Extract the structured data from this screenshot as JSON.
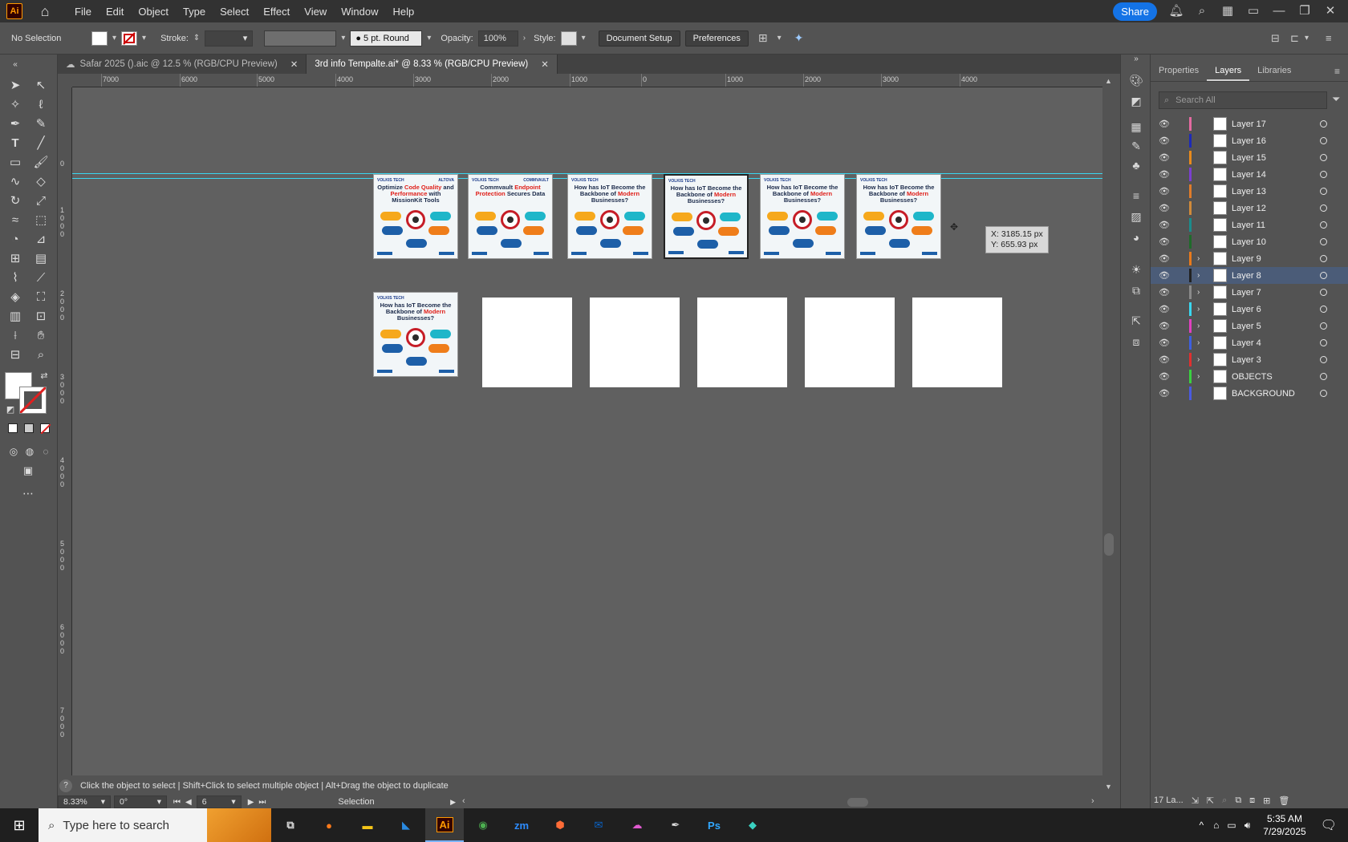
{
  "app": {
    "logo": "Ai",
    "menu": [
      "File",
      "Edit",
      "Object",
      "Type",
      "Select",
      "Effect",
      "View",
      "Window",
      "Help"
    ],
    "share_label": "Share"
  },
  "control": {
    "selection": "No Selection",
    "stroke_label": "Stroke:",
    "brush": "5 pt. Round",
    "opacity_label": "Opacity:",
    "opacity_value": "100%",
    "style_label": "Style:",
    "document_setup": "Document Setup",
    "preferences": "Preferences"
  },
  "tabs": [
    {
      "label": "Safar 2025 ().aic @ 12.5 % (RGB/CPU Preview)"
    },
    {
      "label": "3rd info Tempalte.ai* @ 8.33 % (RGB/CPU Preview)"
    }
  ],
  "ruler_top": [
    "7000",
    "6000",
    "5000",
    "4000",
    "3000",
    "2000",
    "1000",
    "0",
    "1000",
    "2000",
    "3000",
    "4000"
  ],
  "ruler_left": [
    "0",
    "1000",
    "2000",
    "3000",
    "4000",
    "5000",
    "6000",
    "7000"
  ],
  "infographics": [
    {
      "brand": "VOLKIS TECH",
      "partner": "ALTOVA",
      "title_a": "Optimize ",
      "title_red": "Code Quality",
      "title_b": " and ",
      "title_red2": "Performance",
      "title_c": " with MissionKit Tools"
    },
    {
      "brand": "VOLKIS TECH",
      "partner": "COMMVAULT",
      "title_a": "Commvault ",
      "title_red": "Endpoint Protection",
      "title_b": " Secures Data",
      "title_red2": "",
      "title_c": ""
    },
    {
      "brand": "VOLKIS TECH",
      "partner": "",
      "title_a": "How has IoT Become the Backbone of ",
      "title_red": "Modern",
      "title_b": " Businesses?",
      "title_red2": "",
      "title_c": ""
    },
    {
      "brand": "VOLKIS TECH",
      "partner": "",
      "title_a": "How has IoT Become the Backbone of ",
      "title_red": "Modern",
      "title_b": " Businesses?",
      "title_red2": "",
      "title_c": ""
    },
    {
      "brand": "VOLKIS TECH",
      "partner": "",
      "title_a": "How has IoT Become the Backbone of ",
      "title_red": "Modern",
      "title_b": " Businesses?",
      "title_red2": "",
      "title_c": ""
    },
    {
      "brand": "VOLKIS TECH",
      "partner": "",
      "title_a": "How has IoT Become the Backbone of ",
      "title_red": "Modern",
      "title_b": " Businesses?",
      "title_red2": "",
      "title_c": ""
    },
    {
      "brand": "VOLKIS TECH",
      "partner": "",
      "title_a": "How has IoT Become the Backbone of ",
      "title_red": "Modern",
      "title_b": " Businesses?",
      "title_red2": "",
      "title_c": ""
    }
  ],
  "tooltip": {
    "x": "X: 3185.15 px",
    "y": "Y: 655.93 px"
  },
  "status": {
    "hint": "Click the object to select  |  Shift+Click to select multiple object  |  Alt+Drag the object to duplicate",
    "zoom": "8.33%",
    "rotation": "0°",
    "artboard": "6",
    "mode": "Selection"
  },
  "panel": {
    "tabs": [
      "Properties",
      "Layers",
      "Libraries"
    ],
    "search_placeholder": "Search All",
    "layers": [
      {
        "name": "Layer 17",
        "color": "#e46aa0",
        "has_children": false
      },
      {
        "name": "Layer 16",
        "color": "#1d2ab8",
        "has_children": false
      },
      {
        "name": "Layer 15",
        "color": "#e88a1c",
        "has_children": false
      },
      {
        "name": "Layer 14",
        "color": "#7b3fd0",
        "has_children": false
      },
      {
        "name": "Layer 13",
        "color": "#e07c2a",
        "has_children": false
      },
      {
        "name": "Layer 12",
        "color": "#d08a3a",
        "has_children": false
      },
      {
        "name": "Layer 11",
        "color": "#1b8c8c",
        "has_children": false
      },
      {
        "name": "Layer 10",
        "color": "#1f6b2a",
        "has_children": false
      },
      {
        "name": "Layer 9",
        "color": "#e87a1c",
        "has_children": true
      },
      {
        "name": "Layer 8",
        "color": "#222222",
        "has_children": true
      },
      {
        "name": "Layer 7",
        "color": "#8a8a8a",
        "has_children": true
      },
      {
        "name": "Layer 6",
        "color": "#3ad7f0",
        "has_children": true
      },
      {
        "name": "Layer 5",
        "color": "#e040c0",
        "has_children": true
      },
      {
        "name": "Layer 4",
        "color": "#3d5fe0",
        "has_children": true
      },
      {
        "name": "Layer 3",
        "color": "#e03030",
        "has_children": true
      },
      {
        "name": "OBJECTS",
        "color": "#3ad040",
        "has_children": true
      },
      {
        "name": "BACKGROUND",
        "color": "#4a5ae0",
        "has_children": false
      }
    ],
    "footer_count": "17 La..."
  },
  "taskbar": {
    "search_placeholder": "Type here to search",
    "apps": [
      "Firefox",
      "Files",
      "VS Code",
      "Ai",
      "Chrome",
      "Zoom",
      "Postman",
      "Outlook",
      "CC",
      "Pen",
      "Ps",
      "App"
    ],
    "time": "5:35 AM",
    "date": "7/29/2025"
  }
}
